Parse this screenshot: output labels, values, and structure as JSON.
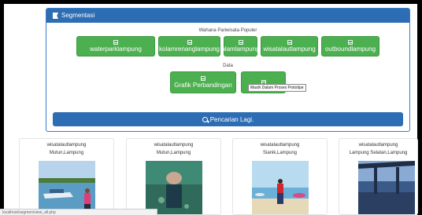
{
  "panel": {
    "title": "Segmentasi",
    "section1_label": "Wahana Pariwisata Populer",
    "category_buttons": [
      "waterparklampung",
      "kolamrenanglampung",
      "alamlampung",
      "wisatalautlampung",
      "outboundlampung"
    ],
    "section2_label": "Data",
    "data_buttons": [
      "Grafik Perbandingan",
      ""
    ],
    "tooltip": "Masih Dalam Proses Prototipe",
    "search_button": "Pencarian Lagi."
  },
  "cards": [
    {
      "category": "wisatalautlampung",
      "location": "Mutun,Lampung"
    },
    {
      "category": "wisatalautlampung",
      "location": "Mutun,Lampung"
    },
    {
      "category": "wisatalautlampung",
      "location": "Sianik,Lampung"
    },
    {
      "category": "wisatalautlampung",
      "location": "Lampung Selatan,Lampung"
    }
  ],
  "status_bar": "localhost/segmen/view_all.php",
  "colors": {
    "primary": "#2d6db3",
    "success": "#4caf50"
  }
}
